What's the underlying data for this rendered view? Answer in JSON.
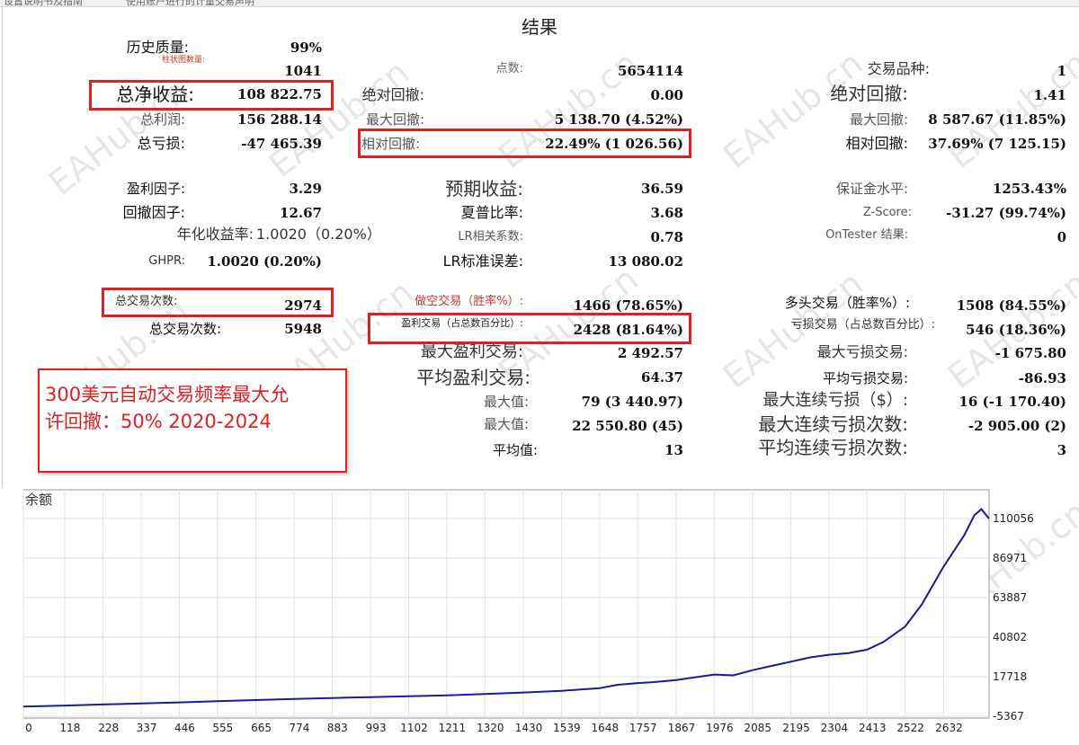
{
  "header": {
    "tab1": "设置说明书及指南",
    "tab2": "使用账户进行的计量交易声明",
    "title": "结果"
  },
  "col1": {
    "hist_quality": {
      "label": "历史质量:",
      "value": "99%"
    },
    "bars": {
      "label": "柱状图数量:",
      "value": "1041"
    },
    "net_profit": {
      "label": "总净收益:",
      "value": "108 822.75"
    },
    "gross_profit": {
      "label": "总利润:",
      "value": "156 288.14"
    },
    "gross_loss": {
      "label": "总亏损:",
      "value": "-47 465.39"
    },
    "profit_factor": {
      "label": "盈利因子:",
      "value": "3.29"
    },
    "recovery_factor": {
      "label": "回撤因子:",
      "value": "12.67"
    },
    "ahpr": {
      "label": "年化收益率:",
      "value": "1.0020（0.20%）"
    },
    "ghpr": {
      "label": "GHPR:",
      "value": "1.0020 (0.20%)"
    },
    "total_trades": {
      "label": "总交易次数:",
      "value": "2974"
    },
    "total_deals": {
      "label": "总交易次数:",
      "value": "5948"
    }
  },
  "col2": {
    "ticks": {
      "label": "点数:",
      "value": "5654114"
    },
    "abs_dd": {
      "label": "绝对回撤:",
      "value": "0.00"
    },
    "max_dd": {
      "label": "最大回撤:",
      "value": "5 138.70 (4.52%)"
    },
    "rel_dd": {
      "label": "相对回撤:",
      "value": "22.49% (1 026.56)"
    },
    "expected_payoff": {
      "label": "预期收益:",
      "value": "36.59"
    },
    "sharpe": {
      "label": "夏普比率:",
      "value": "3.68"
    },
    "lr_corr": {
      "label": "LR相关系数:",
      "value": "0.78"
    },
    "lr_std": {
      "label": "LR标准误差:",
      "value": "13 080.02"
    },
    "short_trades": {
      "label": "做空交易（胜率%）:",
      "value": "1466 (78.65%)"
    },
    "profit_trades": {
      "label": "盈利交易（占总数百分比）:",
      "value": "2428 (81.64%)"
    },
    "largest_profit": {
      "label": "最大盈利交易:",
      "value": "2 492.57"
    },
    "avg_profit": {
      "label": "平均盈利交易:",
      "value": "64.37"
    },
    "max_consec_wins": {
      "label": "最大值:",
      "value": "79 (3 440.97)"
    },
    "max_consec_profit": {
      "label": "最大值:",
      "value": "22 550.80 (45)"
    },
    "avg_consec_wins": {
      "label": "平均值:",
      "value": "13"
    }
  },
  "col3": {
    "symbols": {
      "label": "交易品种:",
      "value": "1"
    },
    "abs_dd": {
      "label": "绝对回撤:",
      "value": "1.41"
    },
    "max_dd": {
      "label": "最大回撤:",
      "value": "8 587.67 (11.85%)"
    },
    "rel_dd": {
      "label": "相对回撤:",
      "value": "37.69% (7 125.15)"
    },
    "margin_level": {
      "label": "保证金水平:",
      "value": "1253.43%"
    },
    "zscore": {
      "label": "Z-Score:",
      "value": "-31.27 (99.74%)"
    },
    "ontester": {
      "label": "OnTester 结果:",
      "value": "0"
    },
    "long_trades": {
      "label": "多头交易（胜率%）:",
      "value": "1508 (84.55%)"
    },
    "loss_trades": {
      "label": "亏损交易（占总数百分比）:",
      "value": "546 (18.36%)"
    },
    "largest_loss": {
      "label": "最大亏损交易:",
      "value": "-1 675.80"
    },
    "avg_loss": {
      "label": "平均亏损交易:",
      "value": "-86.93"
    },
    "max_consec_losses": {
      "label": "最大连续亏损（$）:",
      "value": "16 (-1 170.40)"
    },
    "max_consec_loss_count": {
      "label": "最大连续亏损次数:",
      "value": "-2 905.00 (2)"
    },
    "avg_consec_losses": {
      "label": "平均连续亏损次数:",
      "value": "3"
    }
  },
  "note": {
    "line1": "300美元自动交易频率最大允",
    "line2": "许回撤：50% 2020-2024"
  },
  "watermark": "EAHub.cn",
  "colors": {
    "highlight": "#e02020",
    "curve": "#1a1a9a",
    "grid": "#e2e2e2"
  },
  "chart_data": {
    "type": "line",
    "title": "余额",
    "x_ticks": [
      0,
      118,
      228,
      337,
      446,
      555,
      665,
      774,
      883,
      993,
      1102,
      1211,
      1320,
      1430,
      1539,
      1648,
      1757,
      1867,
      1976,
      2085,
      2195,
      2304,
      2413,
      2522,
      2632
    ],
    "y_ticks": [
      110056,
      86971,
      63887,
      40802,
      17718,
      -5367
    ],
    "xlim": [
      0,
      2762
    ],
    "ylim": [
      -5367,
      120000
    ],
    "grid": true,
    "series": [
      {
        "values": [
          [
            0,
            300
          ],
          [
            118,
            900
          ],
          [
            228,
            1500
          ],
          [
            337,
            2100
          ],
          [
            446,
            2700
          ],
          [
            555,
            3400
          ],
          [
            665,
            4100
          ],
          [
            774,
            4700
          ],
          [
            883,
            5300
          ],
          [
            993,
            5800
          ],
          [
            1102,
            6300
          ],
          [
            1211,
            6800
          ],
          [
            1320,
            7600
          ],
          [
            1430,
            8500
          ],
          [
            1539,
            9500
          ],
          [
            1648,
            11000
          ],
          [
            1700,
            13000
          ],
          [
            1757,
            14000
          ],
          [
            1800,
            14500
          ],
          [
            1867,
            15800
          ],
          [
            1976,
            19000
          ],
          [
            2030,
            18500
          ],
          [
            2085,
            21500
          ],
          [
            2140,
            24000
          ],
          [
            2195,
            26500
          ],
          [
            2250,
            29000
          ],
          [
            2304,
            30500
          ],
          [
            2360,
            31500
          ],
          [
            2413,
            33500
          ],
          [
            2460,
            38000
          ],
          [
            2522,
            47000
          ],
          [
            2570,
            60000
          ],
          [
            2632,
            82000
          ],
          [
            2690,
            100000
          ],
          [
            2720,
            112000
          ],
          [
            2740,
            115500
          ],
          [
            2762,
            110056
          ]
        ]
      }
    ]
  }
}
